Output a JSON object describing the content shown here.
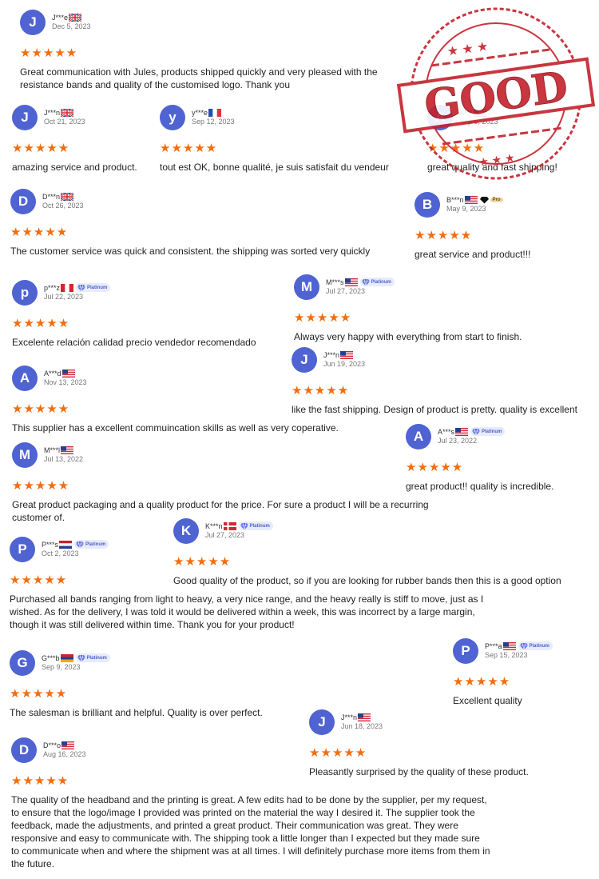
{
  "colors": {
    "avatar": "#4f63d2",
    "star": "#f26d0f",
    "badge_text": "#4b5fce"
  },
  "stars": "★★★★★",
  "stamp": {
    "word": "GOOD"
  },
  "reviews": [
    {
      "initial": "J",
      "user": "J***e",
      "flag": "GB",
      "date": "Dec 5, 2023",
      "text": "Great communication with Jules, products shipped quickly and very pleased with the resistance bands and quality of the customised logo. Thank you"
    },
    {
      "initial": "J",
      "user": "J***n",
      "flag": "GB",
      "date": "Oct 21, 2023",
      "text": "amazing service and product."
    },
    {
      "initial": "y",
      "user": "y***e",
      "flag": "FR",
      "date": "Sep 12, 2023",
      "text": "tout est OK, bonne qualité, je suis satisfait du vendeur"
    },
    {
      "initial": "A",
      "user": "A***",
      "flag": "US",
      "date": "Sep 9, 2023",
      "text": "great quality and fast shipping!"
    },
    {
      "initial": "D",
      "user": "D***n",
      "flag": "GB",
      "date": "Oct 26, 2023",
      "text": "The customer service was quick and consistent. the shipping was sorted very quickly"
    },
    {
      "initial": "B",
      "user": "B***n",
      "flag": "US",
      "badge": "Pro",
      "date": "May 9, 2023",
      "text": "great service and product!!!"
    },
    {
      "initial": "p",
      "user": "p***z",
      "flag": "PE",
      "badge": "Platinum",
      "date": "Jul 22, 2023",
      "text": "Excelente relación calidad precio vendedor recomendado"
    },
    {
      "initial": "M",
      "user": "M***s",
      "flag": "US",
      "badge": "Platinum",
      "date": "Jul 27, 2023",
      "text": "Always very happy with everything from start to finish."
    },
    {
      "initial": "J",
      "user": "J***n",
      "flag": "US",
      "date": "Jun 19, 2023",
      "text": "like the fast shipping. Design of product is pretty. quality is excellent"
    },
    {
      "initial": "A",
      "user": "A***d",
      "flag": "US",
      "date": "Nov 13, 2023",
      "text": "This supplier has a excellent commuincation skills as well as very coperative."
    },
    {
      "initial": "A",
      "user": "A***s",
      "flag": "US",
      "badge": "Platinum",
      "date": "Jul 23, 2022",
      "text": "great product!! quality is incredible."
    },
    {
      "initial": "M",
      "user": "M***l",
      "flag": "US",
      "date": "Jul 13, 2022",
      "text": "Great product packaging and a quality product for the price. For sure a product I will be a recurring customer of."
    },
    {
      "initial": "K",
      "user": "K***n",
      "flag": "DK",
      "badge": "Platinum",
      "date": "Jul 27, 2023",
      "text": "Good quality of the product, so if you are looking for rubber bands then this is a good option"
    },
    {
      "initial": "P",
      "user": "P***s",
      "flag": "NL",
      "badge": "Platinum",
      "date": "Oct 2, 2023",
      "text": "Purchased all bands ranging from light to heavy, a very nice range, and the heavy really is stiff to move, just as I wished. As for the delivery, I was told it would be delivered within a week, this was incorrect by a large margin, though it was still delivered within time. Thank you for your product!"
    },
    {
      "initial": "P",
      "user": "P***a",
      "flag": "US",
      "badge": "Platinum",
      "date": "Sep 15, 2023",
      "text": "Excellent quality"
    },
    {
      "initial": "G",
      "user": "G***b",
      "flag": "AM",
      "badge": "Platinum",
      "date": "Sep 9, 2023",
      "text": "The salesman is brilliant and helpful. Quality is over perfect."
    },
    {
      "initial": "J",
      "user": "J***n",
      "flag": "US",
      "date": "Jun 18, 2023",
      "text": "Pleasantly surprised by the quality of these product."
    },
    {
      "initial": "D",
      "user": "D***o",
      "flag": "US",
      "date": "Aug 16, 2023",
      "text": "The quality of the headband and the printing is great. A few edits had to be done by the supplier, per my request, to ensure that the logo/image I provided was printed on the material the way I desired it. The supplier took the feedback, made the adjustments, and printed a great product. Their communication was great. They were responsive and easy to communicate with. The shipping took a little longer than I expected but they made sure to communicate when and where the shipment was at all times. I will definitely purchase more items from them in the future."
    }
  ]
}
